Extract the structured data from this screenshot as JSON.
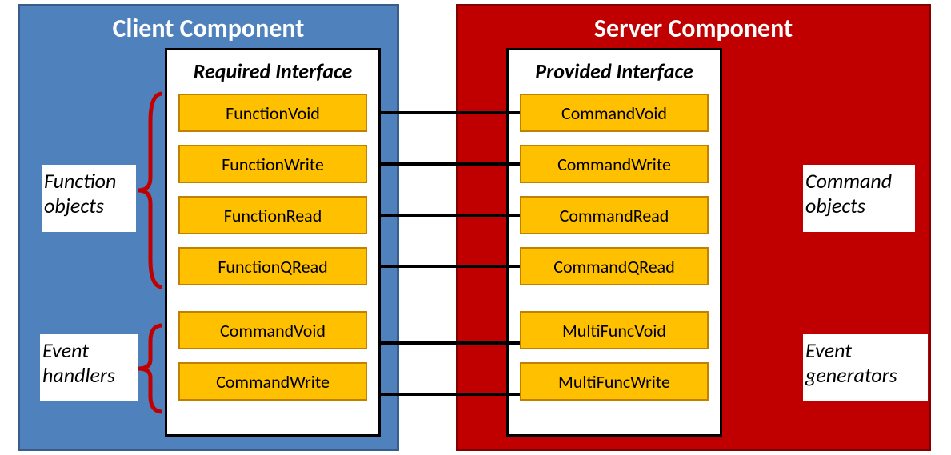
{
  "client": {
    "title": "Client Component",
    "interface_title": "Required Interface",
    "group_a": [
      "FunctionVoid",
      "FunctionWrite",
      "FunctionRead",
      "FunctionQRead"
    ],
    "group_b": [
      "CommandVoid",
      "CommandWrite"
    ],
    "label_a": "Function objects",
    "label_b": "Event handlers"
  },
  "server": {
    "title": "Server Component",
    "interface_title": "Provided Interface",
    "group_a": [
      "CommandVoid",
      "CommandWrite",
      "CommandRead",
      "CommandQRead"
    ],
    "group_b": [
      "MultiFuncVoid",
      "MultiFuncWrite"
    ],
    "label_a": "Command objects",
    "label_b": "Event generators"
  },
  "colors": {
    "client_bg": "#4f81bd",
    "server_bg": "#c00000",
    "item_bg": "#ffc000"
  }
}
